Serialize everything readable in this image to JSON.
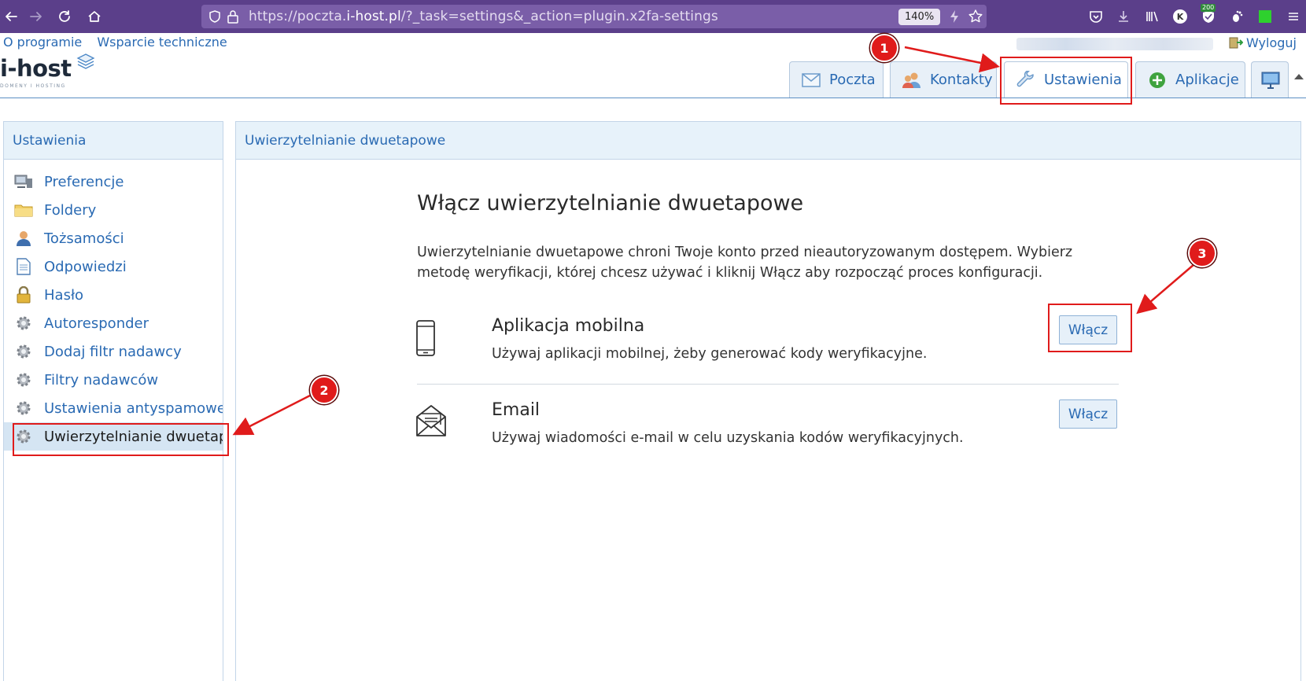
{
  "browser": {
    "url_prefix": "https://poczta.",
    "url_host": "i-host.pl",
    "url_path": "/?_task=settings&_action=plugin.x2fa-settings",
    "zoom": "140%",
    "badge_count": "200"
  },
  "header": {
    "links": [
      "O programie",
      "Wsparcie techniczne"
    ],
    "logo_text": "i-host",
    "logo_tagline": "DOMENY I HOSTING",
    "logout_label": "Wyloguj"
  },
  "tabs": [
    {
      "label": "Poczta",
      "icon": "mail-icon"
    },
    {
      "label": "Kontakty",
      "icon": "contacts-icon"
    },
    {
      "label": "Ustawienia",
      "icon": "wrench-icon",
      "active": true
    },
    {
      "label": "Aplikacje",
      "icon": "plus-circle-icon"
    }
  ],
  "sidebar": {
    "title": "Ustawienia",
    "items": [
      {
        "label": "Preferencje",
        "icon": "monitor-icon"
      },
      {
        "label": "Foldery",
        "icon": "folder-icon"
      },
      {
        "label": "Tożsamości",
        "icon": "user-icon"
      },
      {
        "label": "Odpowiedzi",
        "icon": "document-icon"
      },
      {
        "label": "Hasło",
        "icon": "lock-icon"
      },
      {
        "label": "Autoresponder",
        "icon": "gear-icon"
      },
      {
        "label": "Dodaj filtr nadawcy",
        "icon": "gear-icon"
      },
      {
        "label": "Filtry nadawców",
        "icon": "gear-icon"
      },
      {
        "label": "Ustawienia antyspamowe",
        "icon": "gear-icon"
      },
      {
        "label": "Uwierzytelnianie dwuetap",
        "icon": "gear-icon",
        "selected": true
      }
    ]
  },
  "content": {
    "panel_title": "Uwierzytelnianie dwuetapowe",
    "title": "Włącz uwierzytelnianie dwuetapowe",
    "description": "Uwierzytelnianie dwuetapowe chroni Twoje konto przed nieautoryzowanym dostępem. Wybierz metodę weryfikacji, której chcesz używać i kliknij Włącz aby rozpocząć proces konfiguracji.",
    "methods": [
      {
        "name": "Aplikacja mobilna",
        "description": "Używaj aplikacji mobilnej, żeby generować kody weryfikacyjne.",
        "button": "Włącz",
        "icon": "smartphone-icon"
      },
      {
        "name": "Email",
        "description": "Używaj wiadomości e-mail w celu uzyskania kodów weryfikacyjnych.",
        "button": "Włącz",
        "icon": "envelope-open-icon"
      }
    ]
  },
  "annotations": {
    "color": "#e01b1b",
    "markers": [
      "1",
      "2",
      "3"
    ]
  },
  "colors": {
    "browser_bar": "#5b3f8a",
    "link": "#2a6ab3",
    "panel_header": "#e7f2fa",
    "selected_row": "#d5e5f3"
  }
}
